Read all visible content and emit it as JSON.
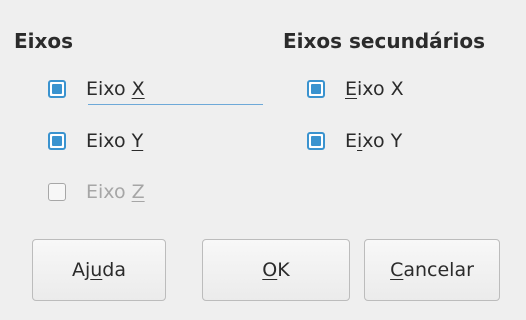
{
  "sections": {
    "primary": {
      "title": "Eixos",
      "items": [
        {
          "pre": "Eixo ",
          "key": "X",
          "post": "",
          "checked": true,
          "enabled": true
        },
        {
          "pre": "Eixo ",
          "key": "Y",
          "post": "",
          "checked": true,
          "enabled": true
        },
        {
          "pre": "Eixo ",
          "key": "Z",
          "post": "",
          "checked": false,
          "enabled": false
        }
      ]
    },
    "secondary": {
      "title": "Eixos secundários",
      "items": [
        {
          "pre": "",
          "key": "E",
          "post": "ixo X",
          "checked": true,
          "enabled": true
        },
        {
          "pre": "E",
          "key": "i",
          "post": "xo Y",
          "checked": true,
          "enabled": true
        }
      ]
    }
  },
  "buttons": {
    "help": {
      "pre": "Aj",
      "key": "u",
      "post": "da"
    },
    "ok": {
      "pre": "",
      "key": "O",
      "post": "K"
    },
    "cancel": {
      "pre": "",
      "key": "C",
      "post": "ancelar"
    }
  },
  "colors": {
    "accent": "#3a93cf",
    "background": "#efefef",
    "disabled_text": "#a6a6a6"
  }
}
